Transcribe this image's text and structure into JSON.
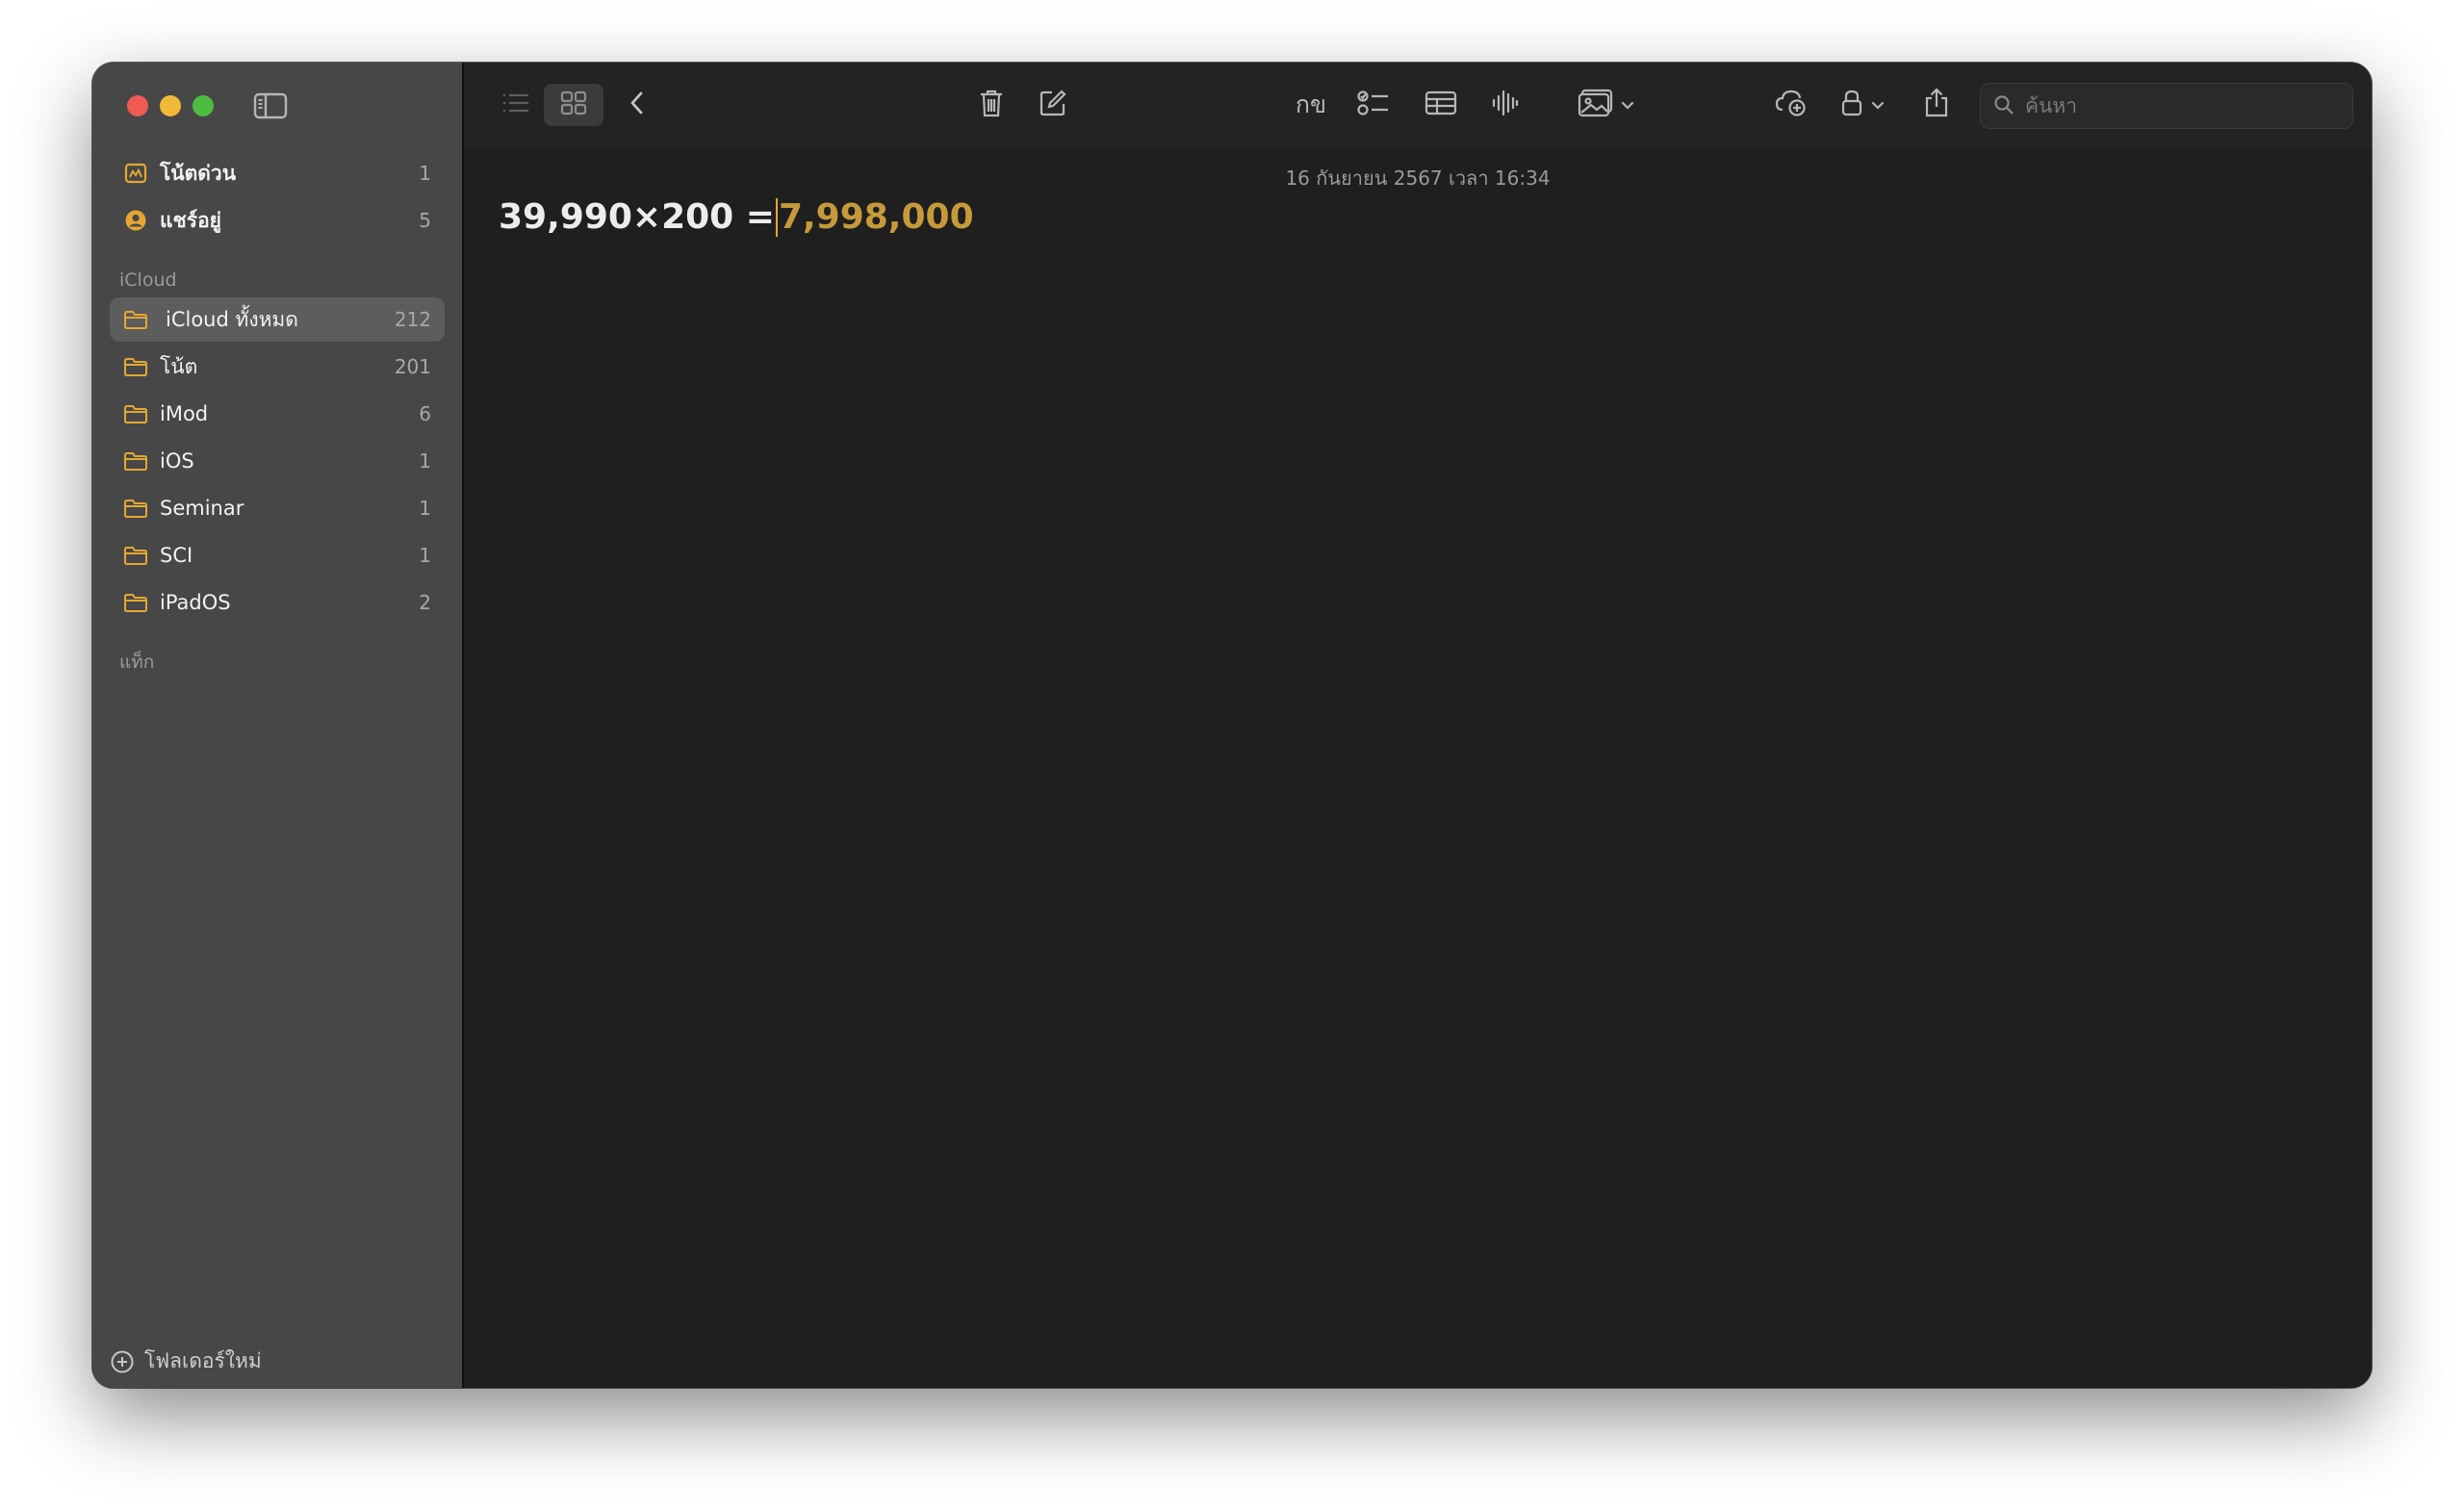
{
  "sidebar": {
    "pinned": [
      {
        "label": "โน้ตด่วน",
        "count": "1",
        "icon": "quick-note-icon"
      },
      {
        "label": "แชร์อยู่",
        "count": "5",
        "icon": "shared-person-icon"
      }
    ],
    "icloud_header": "iCloud",
    "folders": [
      {
        "label": "iCloud ทั้งหมด",
        "count": "212",
        "selected": true
      },
      {
        "label": "โน้ต",
        "count": "201"
      },
      {
        "label": "iMod",
        "count": "6"
      },
      {
        "label": "iOS",
        "count": "1"
      },
      {
        "label": "Seminar",
        "count": "1"
      },
      {
        "label": "SCI",
        "count": "1"
      },
      {
        "label": "iPadOS",
        "count": "2"
      }
    ],
    "tags_header": "แท็ก",
    "new_folder_label": "โฟลเดอร์ใหม่"
  },
  "toolbar": {
    "format_label": "กข",
    "search_placeholder": "ค้นหา"
  },
  "note": {
    "date": "16 กันยายน 2567 เวลา 16:34",
    "expression": "39,990×200 =",
    "result": "7,998,000"
  },
  "colors": {
    "accent": "#e5a732",
    "result_text": "#c59a3a",
    "sidebar_bg": "#474747",
    "editor_bg": "#1f1f1f"
  }
}
